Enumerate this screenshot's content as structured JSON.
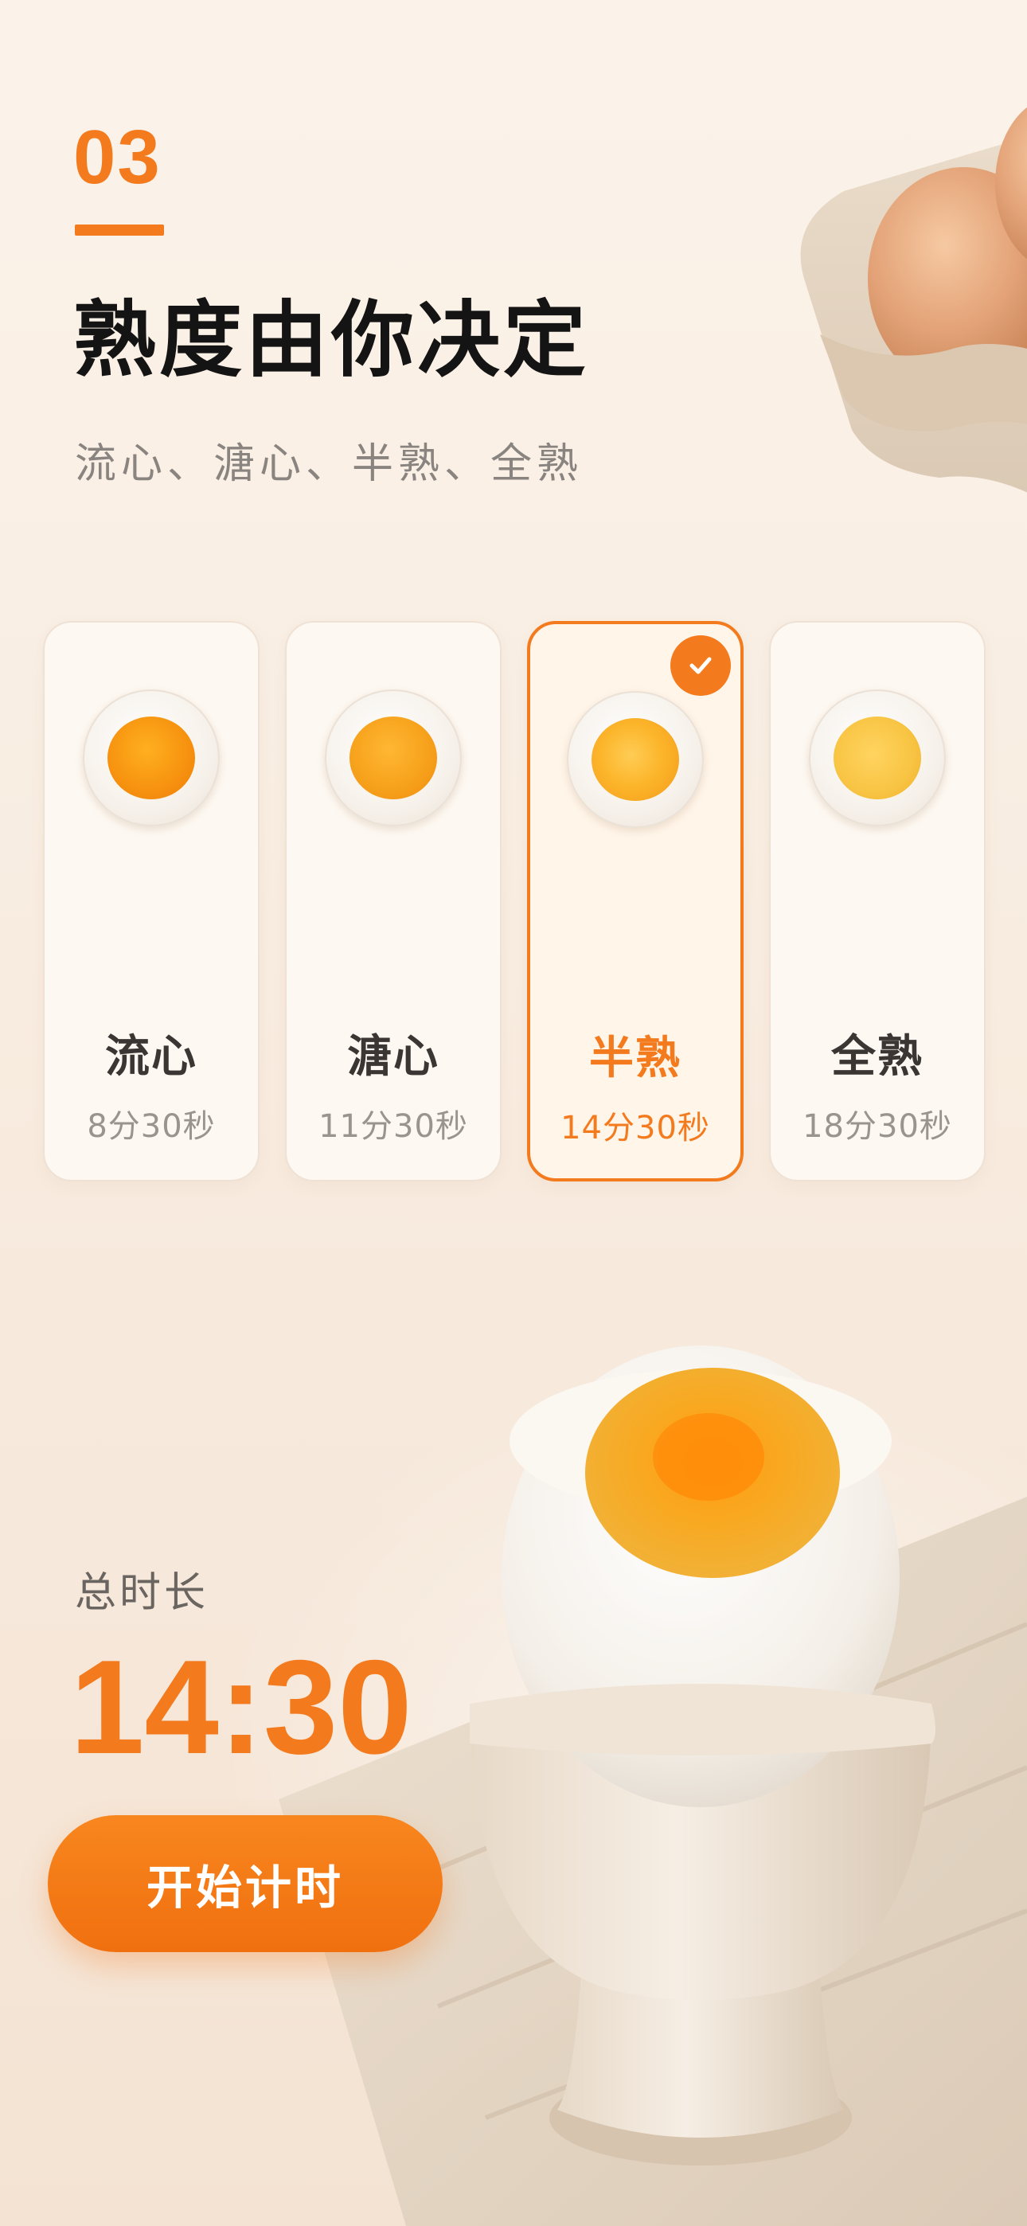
{
  "header": {
    "step": "03",
    "title": "熟度由你决定",
    "subtitle": "流心、溏心、半熟、全熟"
  },
  "options": [
    {
      "label": "流心",
      "time": "8分30秒",
      "selected": false,
      "yolk": "runny"
    },
    {
      "label": "溏心",
      "time": "11分30秒",
      "selected": false,
      "yolk": "jammy"
    },
    {
      "label": "半熟",
      "time": "14分30秒",
      "selected": true,
      "yolk": "medium"
    },
    {
      "label": "全熟",
      "time": "18分30秒",
      "selected": false,
      "yolk": "hard"
    }
  ],
  "total": {
    "label": "总时长",
    "value": "14:30"
  },
  "actions": {
    "start_label": "开始计时"
  },
  "colors": {
    "accent": "#f47a1e",
    "background": "#f8ece0",
    "title": "#141414"
  },
  "icons": {
    "selected_check": "check-icon"
  }
}
